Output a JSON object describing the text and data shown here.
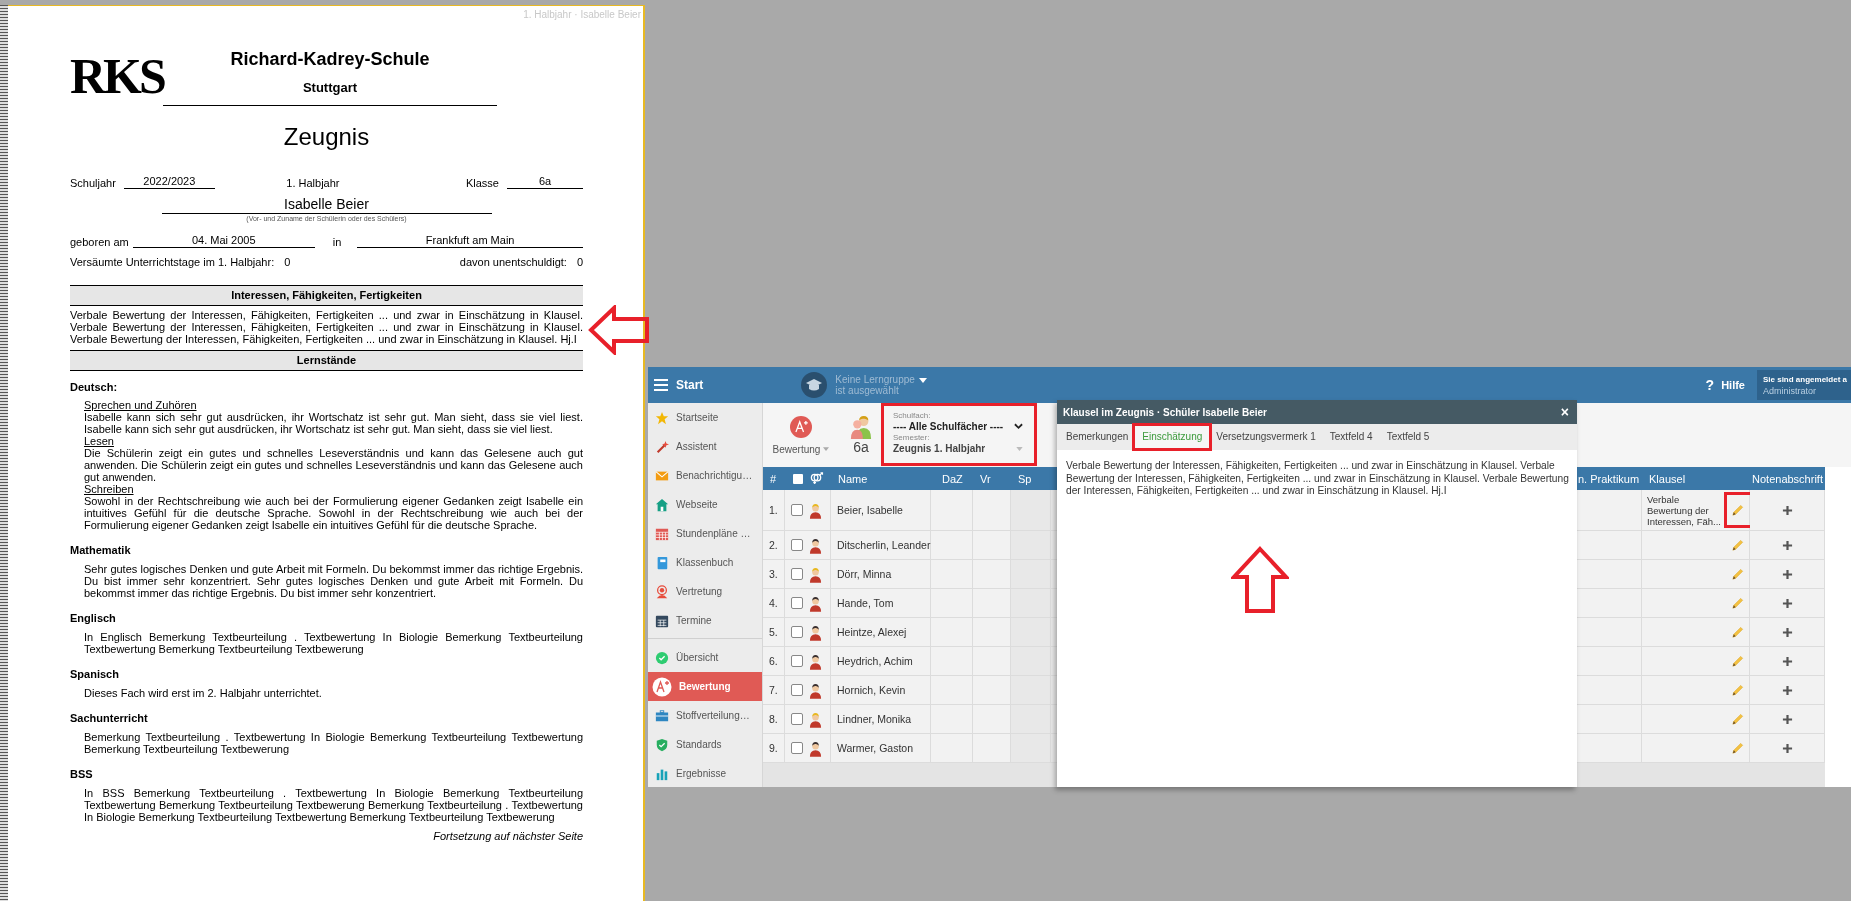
{
  "document": {
    "running_head": "1. Halbjahr · Isabelle Beier",
    "logo": "RKS",
    "school_name": "Richard-Kadrey-Schule",
    "city": "Stuttgart",
    "title": "Zeugnis",
    "school_year_label": "Schuljahr",
    "school_year": "2022/2023",
    "half_year": "1. Halbjahr",
    "class_label": "Klasse",
    "class": "6a",
    "student_name": "Isabelle Beier",
    "student_name_caption": "(Vor- und Zuname der Schülerin oder des Schülers)",
    "born_label": "geboren am",
    "birth_date": "04. Mai 2005",
    "birthplace_label": "in",
    "birthplace": "Frankfuft am Main",
    "absence_label": "Versäumte Unterrichtstage im 1. Halbjahr:",
    "absence_days": "0",
    "unexcused_label": "davon unentschuldigt:",
    "unexcused_days": "0",
    "interests_heading": "Interessen, Fähigkeiten, Fertigkeiten",
    "interests_text": "Verbale Bewertung der Interessen, Fähigkeiten, Fertigkeiten ... und zwar in Einschätzung in Klausel. Verbale Bewertung der Interessen, Fähigkeiten, Fertigkeiten ... und zwar in Einschätzung in Klausel. Verbale Bewertung der Interessen, Fähigkeiten, Fertigkeiten ... und zwar in Einschätzung in Klausel. Hj.I",
    "progress_heading": "Lernstände",
    "subjects": [
      {
        "name": "Deutsch:",
        "areas": [
          {
            "title": "Sprechen und Zuhören",
            "text": "Isabelle kann sich sehr gut ausdrücken, ihr Wortschatz ist sehr gut. Man sieht, dass sie viel liest. Isabelle kann sich sehr gut ausdrücken, ihr Wortschatz ist sehr gut. Man sieht, dass sie viel liest."
          },
          {
            "title": "Lesen",
            "text": "Die Schülerin zeigt ein gutes und schnelles Leseverständnis und kann das Gelesene auch gut anwenden. Die Schülerin zeigt ein gutes und schnelles Leseverständnis und kann das Gelesene auch gut anwenden."
          },
          {
            "title": "Schreiben",
            "text": "Sowohl in der Rechtschreibung wie auch bei der Formulierung eigener Gedanken zeigt Isabelle ein intuitives Gefühl für die deutsche Sprache. Sowohl in der Rechtschreibung wie auch bei der Formulierung eigener Gedanken zeigt Isabelle ein intuitives Gefühl für die deutsche Sprache."
          }
        ]
      },
      {
        "name": "Mathematik",
        "text": "Sehr gutes logisches Denken und gute Arbeit mit Formeln. Du bekommst immer das richtige Ergebnis. Du bist immer sehr konzentriert. Sehr gutes logisches Denken und gute Arbeit mit Formeln. Du bekommst immer das richtige Ergebnis. Du bist immer sehr konzentriert."
      },
      {
        "name": "Englisch",
        "text": "In Englisch Bemerkung Textbeurteilung . Textbewertung In Biologie Bemerkung Textbeurteilung Textbewertung Bemerkung Textbeurteilung Textbewerung"
      },
      {
        "name": "Spanisch",
        "text": "Dieses Fach wird erst im 2. Halbjahr unterrichtet."
      },
      {
        "name": "Sachunterricht",
        "text": "Bemerkung Textbeurteilung . Textbewertung In Biologie Bemerkung Textbeurteilung Textbewertung Bemerkung Textbeurteilung Textbewerung"
      },
      {
        "name": "BSS",
        "text": "In BSS Bemerkung Textbeurteilung . Textbewertung In Biologie Bemerkung Textbeurteilung Textbewertung Bemerkung Textbeurteilung Textbewerung Bemerkung Textbeurteilung . Textbewertung In Biologie Bemerkung Textbeurteilung Textbewertung Bemerkung Textbeurteilung Textbewerung"
      }
    ],
    "continuation": "Fortsetzung auf nächster Seite"
  },
  "app": {
    "topbar": {
      "start": "Start",
      "group_line1": "Keine Lerngruppe",
      "group_line2": "ist ausgewählt",
      "help_mark": "?",
      "help": "Hilfe",
      "user_line1": "Sie sind angemeldet a",
      "user_line2": "Administrator"
    },
    "sidebar": {
      "groups": [
        [
          {
            "label": "Startseite",
            "selected": false
          },
          {
            "label": "Assistent",
            "selected": false
          },
          {
            "label": "Benachrichtigu…",
            "selected": false
          },
          {
            "label": "Webseite",
            "selected": false
          },
          {
            "label": "Stundenpläne …",
            "selected": false
          },
          {
            "label": "Klassenbuch",
            "selected": false
          },
          {
            "label": "Vertretung",
            "selected": false
          },
          {
            "label": "Termine",
            "selected": false
          }
        ],
        [
          {
            "label": "Übersicht",
            "selected": false
          },
          {
            "label": "Bewertung",
            "selected": true
          },
          {
            "label": "Stoffverteilung…",
            "selected": false
          },
          {
            "label": "Standards",
            "selected": false
          },
          {
            "label": "Ergebnisse",
            "selected": false
          }
        ]
      ]
    },
    "toolbar": {
      "rating_button": "Bewertung",
      "class": "6a",
      "subject_label": "Schulfach:",
      "subject": "---- Alle Schulfächer ----",
      "semester_label": "Semester:",
      "semester": "Zeugnis 1. Halbjahr"
    },
    "table": {
      "select_all": {
        "checked": false
      },
      "columns": {
        "number": "#",
        "name": "Name",
        "daz": "DaZ",
        "vr": "Vr",
        "sp": "Sp",
        "praktikum": "n. Praktikum",
        "klausel": "Klausel",
        "transcript": "Notenabschrift"
      },
      "rows": [
        {
          "number": "1.",
          "checked": false,
          "kind": "female",
          "name": "Beier, Isabelle",
          "klausel": "Verbale Bewertung der Interessen, Fäh..."
        },
        {
          "number": "2.",
          "checked": false,
          "kind": "male",
          "name": "Ditscherlin, Leander"
        },
        {
          "number": "3.",
          "checked": false,
          "kind": "female",
          "name": "Dörr, Minna"
        },
        {
          "number": "4.",
          "checked": false,
          "kind": "male",
          "name": "Hande, Tom"
        },
        {
          "number": "5.",
          "checked": false,
          "kind": "male",
          "name": "Heintze, Alexej"
        },
        {
          "number": "6.",
          "checked": false,
          "kind": "male",
          "name": "Heydrich, Achim"
        },
        {
          "number": "7.",
          "checked": false,
          "kind": "male",
          "name": "Hornich, Kevin"
        },
        {
          "number": "8.",
          "checked": false,
          "kind": "female",
          "name": "Lindner, Monika"
        },
        {
          "number": "9.",
          "checked": false,
          "kind": "male",
          "name": "Warmer, Gaston"
        }
      ]
    },
    "modal": {
      "title": "Klausel im Zeugnis · Schüler Isabelle Beier",
      "close": "×",
      "tabs": [
        {
          "label": "Bemerkungen",
          "selected": false
        },
        {
          "label": "Einschätzung",
          "selected": true
        },
        {
          "label": "Versetzungsvermerk 1",
          "selected": false
        },
        {
          "label": "Textfeld 4",
          "selected": false
        },
        {
          "label": "Textfeld 5",
          "selected": false
        }
      ],
      "text": "Verbale Bewertung der Interessen, Fähigkeiten, Fertigkeiten ... und zwar in Einschätzung in Klausel. Verbale Bewertung der Interessen, Fähigkeiten, Fertigkeiten ... und zwar in Einschätzung in Klausel. Verbale Bewertung der Interessen, Fähigkeiten, Fertigkeiten ... und zwar in Einschätzung in Klausel. Hj.I"
    }
  }
}
